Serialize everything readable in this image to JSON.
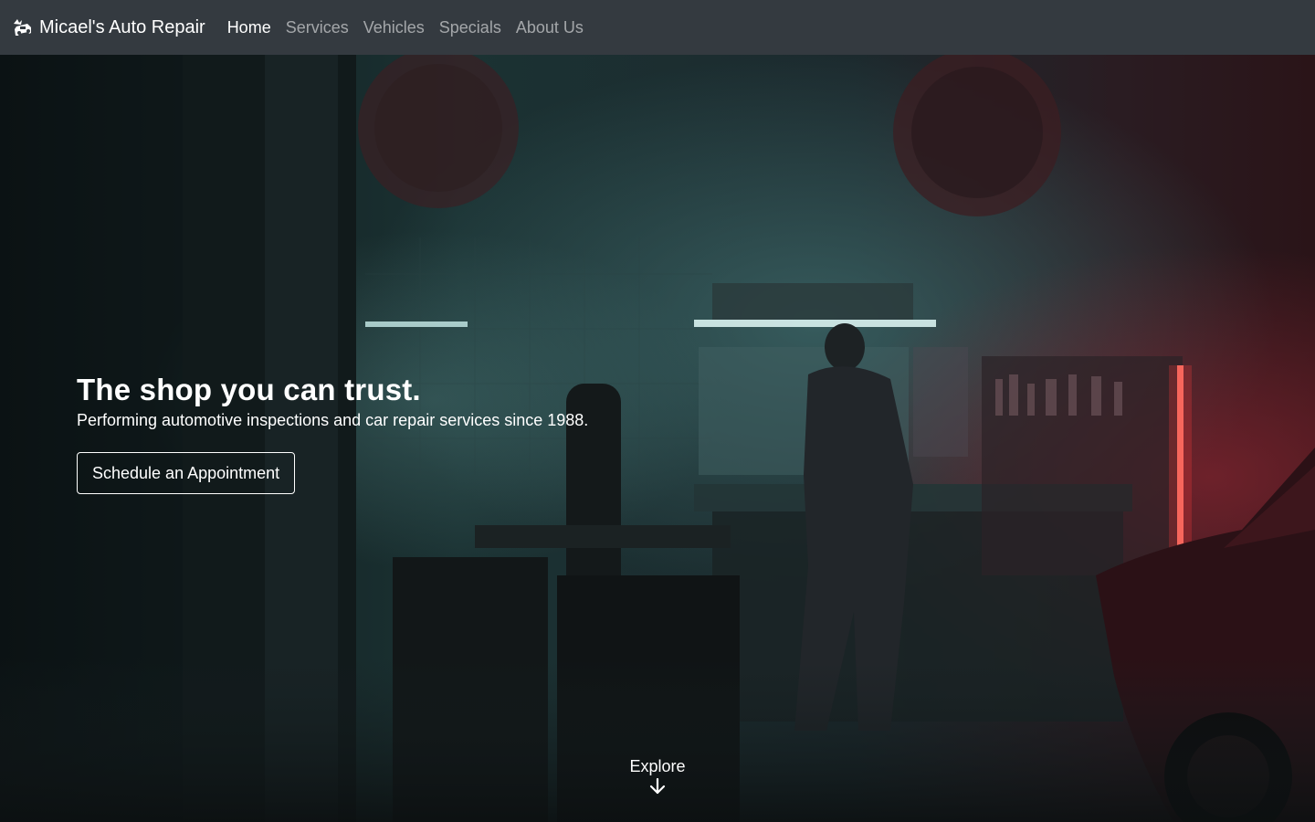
{
  "navbar": {
    "brand": "Micael's Auto Repair",
    "brand_icon": "car-crash-icon",
    "links": [
      {
        "label": "Home",
        "active": true
      },
      {
        "label": "Services",
        "active": false
      },
      {
        "label": "Vehicles",
        "active": false
      },
      {
        "label": "Specials",
        "active": false
      },
      {
        "label": "About Us",
        "active": false
      }
    ]
  },
  "hero": {
    "title": "The shop you can trust.",
    "subtitle": "Performing automotive inspections and car repair services since 1988.",
    "cta_label": "Schedule an Appointment",
    "explore_label": "Explore",
    "explore_icon": "arrow-down-icon"
  },
  "colors": {
    "navbar_bg": "#343a40",
    "text": "#ffffff",
    "nav_inactive": "rgba(255,255,255,0.55)"
  }
}
